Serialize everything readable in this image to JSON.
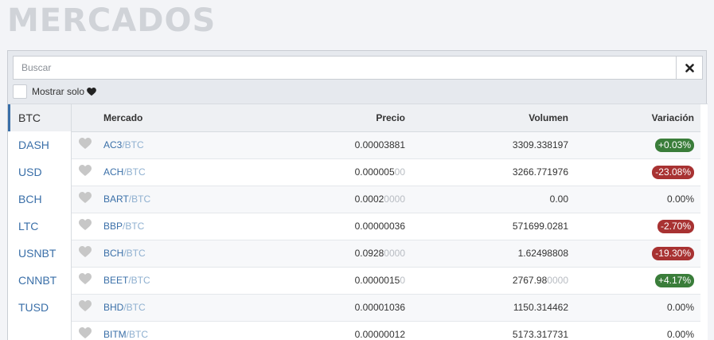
{
  "page": {
    "title": "MERCADOS"
  },
  "search": {
    "placeholder": "Buscar",
    "value": ""
  },
  "filter": {
    "label": "Mostrar solo",
    "icon": "heart-icon"
  },
  "colors": {
    "accent": "#3a6fa8",
    "up": "#3a7d3a",
    "down": "#a83232",
    "heart": "#c7c7c7"
  },
  "sidebar": {
    "items": [
      {
        "label": "BTC",
        "active": true
      },
      {
        "label": "DASH",
        "active": false
      },
      {
        "label": "USD",
        "active": false
      },
      {
        "label": "BCH",
        "active": false
      },
      {
        "label": "LTC",
        "active": false
      },
      {
        "label": "USNBT",
        "active": false
      },
      {
        "label": "CNNBT",
        "active": false
      },
      {
        "label": "TUSD",
        "active": false
      }
    ]
  },
  "table": {
    "headers": {
      "market": "Mercado",
      "price": "Precio",
      "volume": "Volumen",
      "change": "Variación"
    },
    "rows": [
      {
        "base": "AC3",
        "quote": "/BTC",
        "price_main": "0.00003881",
        "price_dim": "",
        "volume_main": "3309.338197",
        "volume_dim": "",
        "change": "+0.03%",
        "trend": "up"
      },
      {
        "base": "ACH",
        "quote": "/BTC",
        "price_main": "0.000005",
        "price_dim": "00",
        "volume_main": "3266.771976",
        "volume_dim": "",
        "change": "-23.08%",
        "trend": "down"
      },
      {
        "base": "BART",
        "quote": "/BTC",
        "price_main": "0.0002",
        "price_dim": "0000",
        "volume_main": "0.00",
        "volume_dim": "",
        "change": "0.00%",
        "trend": "flat"
      },
      {
        "base": "BBP",
        "quote": "/BTC",
        "price_main": "0.00000036",
        "price_dim": "",
        "volume_main": "571699.0281",
        "volume_dim": "",
        "change": "-2.70%",
        "trend": "down"
      },
      {
        "base": "BCH",
        "quote": "/BTC",
        "price_main": "0.0928",
        "price_dim": "0000",
        "volume_main": "1.62498808",
        "volume_dim": "",
        "change": "-19.30%",
        "trend": "down"
      },
      {
        "base": "BEET",
        "quote": "/BTC",
        "price_main": "0.0000015",
        "price_dim": "0",
        "volume_main": "2767.98",
        "volume_dim": "0000",
        "change": "+4.17%",
        "trend": "up"
      },
      {
        "base": "BHD",
        "quote": "/BTC",
        "price_main": "0.00001036",
        "price_dim": "",
        "volume_main": "1150.314462",
        "volume_dim": "",
        "change": "0.00%",
        "trend": "flat"
      },
      {
        "base": "BITM",
        "quote": "/BTC",
        "price_main": "0.00000012",
        "price_dim": "",
        "volume_main": "5173.317731",
        "volume_dim": "",
        "change": "0.00%",
        "trend": "flat"
      }
    ]
  }
}
